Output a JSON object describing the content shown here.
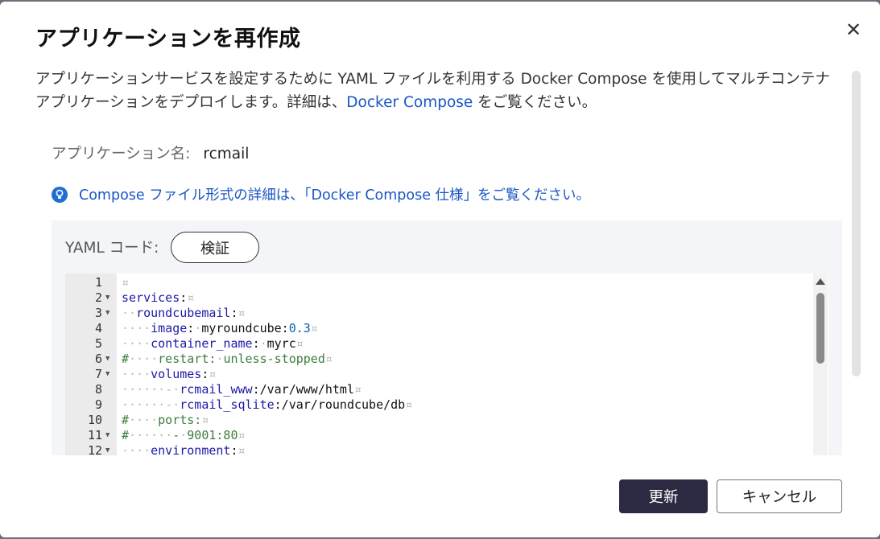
{
  "dialog": {
    "title": "アプリケーションを再作成",
    "close_label": "✕",
    "description_part1": "アプリケーションサービスを設定するために YAML ファイルを利用する Docker Compose を使用してマルチコンテナアプリケーションをデプロイします。詳細は、",
    "description_link": "Docker Compose",
    "description_part2": " をご覧ください。",
    "app_name_label": "アプリケーション名:",
    "app_name_value": "rcmail",
    "tip_part1": "Compose ファイル形式の詳細は、「",
    "tip_link": "Docker Compose 仕様",
    "tip_part2": "」をご覧ください。",
    "tip_icon": "lightbulb-icon",
    "yaml_label": "YAML コード:",
    "verify_button": "検証",
    "editor": {
      "line_numbers": [
        "1",
        "2",
        "3",
        "4",
        "5",
        "6",
        "7",
        "8",
        "9",
        "10",
        "11",
        "12"
      ],
      "whitespace_glyph": "¤",
      "lines": [
        "",
        "services:",
        "··roundcubemail:",
        "····image:·myroundcube:0.3",
        "····container_name:·myrc",
        "#····restart:·unless-stopped",
        "····volumes:",
        "······-·rcmail_www:/var/www/html",
        "······-·rcmail_sqlite:/var/roundcube/db",
        "#····ports:",
        "#······-·9001:80",
        "····environment:"
      ]
    },
    "primary_button": "更新",
    "cancel_button": "キャンセル",
    "colors": {
      "primary": "#2c2942",
      "link": "#1a56c4",
      "comment": "#3d7d3d"
    }
  }
}
